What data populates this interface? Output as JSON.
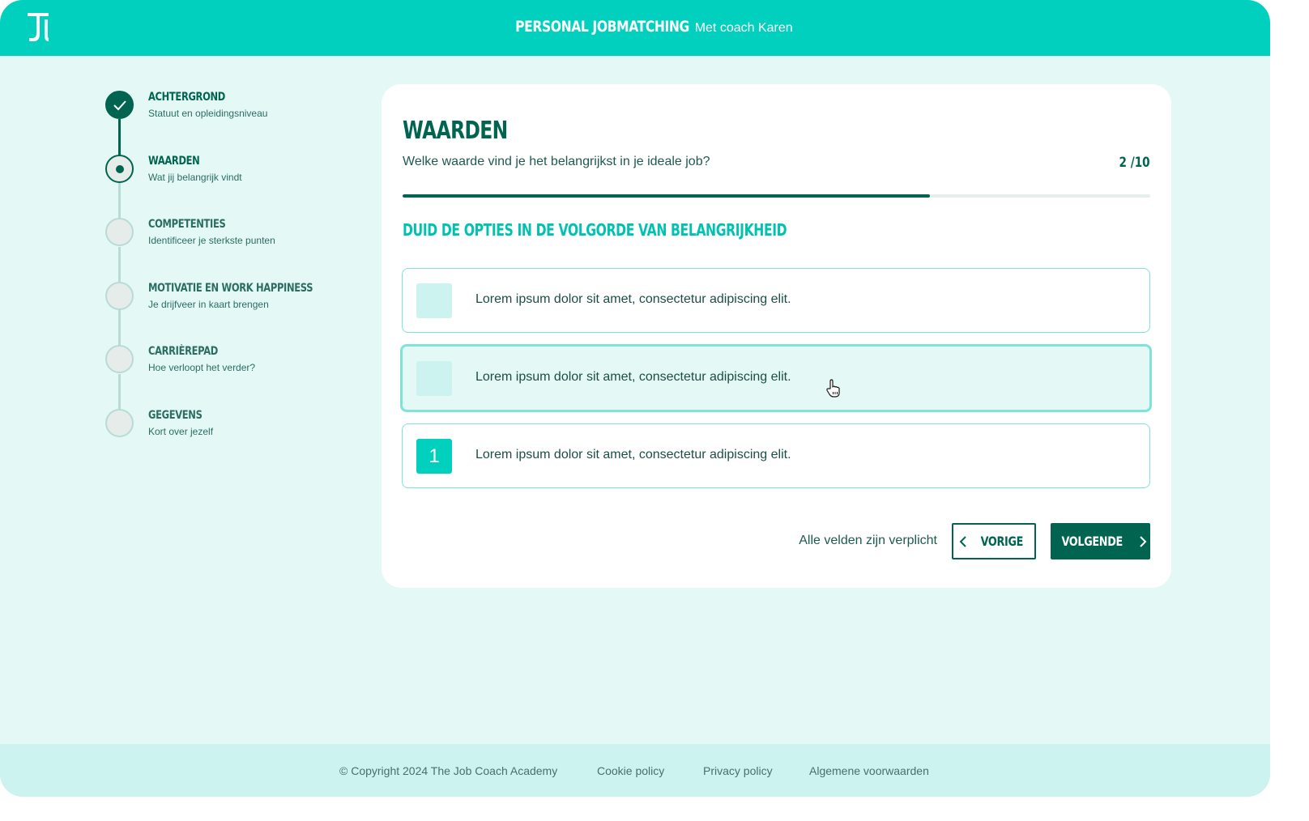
{
  "header": {
    "logo_icon": "jc-monogram-icon",
    "brand": "PERSONAL JOBMATCHING",
    "coach": "Met coach Karen"
  },
  "steps": [
    {
      "label": "ACHTERGROND",
      "sub": "Statuut en opleidingsniveau",
      "state": "done"
    },
    {
      "label": "WAARDEN",
      "sub": "Wat jij belangrijk vindt",
      "state": "current"
    },
    {
      "label": "COMPETENTIES",
      "sub": "Identificeer je sterkste punten",
      "state": "todo"
    },
    {
      "label": "MOTIVATIE EN WORK HAPPINESS",
      "sub": "Je drijfveer in kaart brengen",
      "state": "todo"
    },
    {
      "label": "CARRIÈREPAD",
      "sub": "Hoe verloopt het verder?",
      "state": "todo"
    },
    {
      "label": "GEGEVENS",
      "sub": "Kort over jezelf",
      "state": "todo"
    }
  ],
  "card": {
    "title": "WAARDEN",
    "question": "Welke waarde vind je het belangrijkst in je ideale job?",
    "counter": "2 /10",
    "progress_fraction": 0.705,
    "instruction": "DUID DE OPTIES IN DE VOLGORDE VAN BELANGRIJKHEID",
    "options": [
      {
        "text": "Lorem ipsum dolor sit amet, consectetur adipiscing elit.",
        "rank": ""
      },
      {
        "text": "Lorem ipsum dolor sit amet, consectetur adipiscing elit.",
        "rank": ""
      },
      {
        "text": "Lorem ipsum dolor sit amet, consectetur adipiscing elit.",
        "rank": "1"
      }
    ],
    "required_note": "Alle velden zijn verplicht",
    "prev_label": "VORIGE",
    "next_label": "VOLGENDE"
  },
  "footer": {
    "copyright": "© Copyright 2024 The Job Coach Academy",
    "cookie": "Cookie policy",
    "privacy": "Privacy policy",
    "terms": "Algemene voorwaarden"
  },
  "colors": {
    "brand_teal": "#00d0bd",
    "dark_green": "#006450",
    "background": "#e4f8f6"
  }
}
